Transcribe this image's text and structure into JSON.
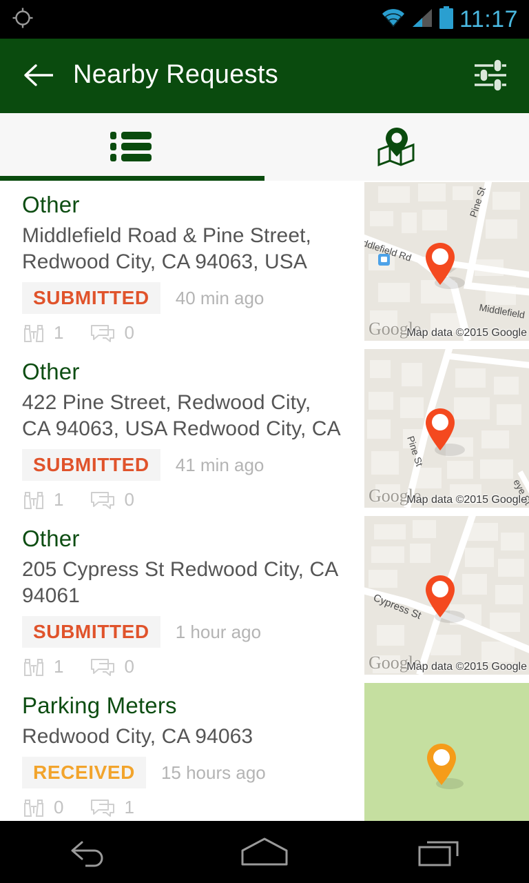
{
  "statusbar": {
    "gps_icon": "gps-crosshair-icon",
    "wifi_icon": "wifi-icon",
    "signal_icon": "cellular-signal-icon",
    "battery_icon": "battery-full-icon",
    "clock": "11:17",
    "accent_color": "#4ab8e0"
  },
  "actionbar": {
    "back_icon": "arrow-left-icon",
    "title": "Nearby Requests",
    "filter_icon": "filter-sliders-icon",
    "background_color": "#0a4b0e"
  },
  "tabs": [
    {
      "id": "list",
      "icon": "list-icon",
      "selected": true
    },
    {
      "id": "map",
      "icon": "map-pin-icon",
      "selected": false
    }
  ],
  "list": {
    "items": [
      {
        "category": "Other",
        "address": "Middlefield Road & Pine Street, Redwood City, CA 94063, USA",
        "status": "SUBMITTED",
        "status_color": "#e0532b",
        "time_ago": "40 min ago",
        "watchers": "1",
        "comments": "0",
        "map": {
          "pin_color": "#f4491f",
          "street_labels": [
            "Middlefield Rd",
            "Pine St",
            "Middlefield"
          ],
          "has_transit_marker": true,
          "logo": "Google",
          "attribution": "Map data ©2015 Google"
        }
      },
      {
        "category": "Other",
        "address": "422 Pine Street, Redwood City, CA 94063, USA Redwood City, CA",
        "status": "SUBMITTED",
        "status_color": "#e0532b",
        "time_ago": "41 min ago",
        "watchers": "1",
        "comments": "0",
        "map": {
          "pin_color": "#f4491f",
          "street_labels": [
            "Pine St",
            "eye St"
          ],
          "has_transit_marker": false,
          "logo": "Google",
          "attribution": "Map data ©2015 Google"
        }
      },
      {
        "category": "Other",
        "address": "205 Cypress St Redwood City, CA 94061",
        "status": "SUBMITTED",
        "status_color": "#e0532b",
        "time_ago": "1 hour ago",
        "watchers": "1",
        "comments": "0",
        "map": {
          "pin_color": "#f4491f",
          "street_labels": [
            "Cypress St"
          ],
          "has_transit_marker": false,
          "logo": "Google",
          "attribution": "Map data ©2015 Google"
        }
      },
      {
        "category": "Parking Meters",
        "address": " Redwood City, CA 94063",
        "status": "RECEIVED",
        "status_color": "#f2a42c",
        "time_ago": "15 hours ago",
        "watchers": "0",
        "comments": "1",
        "map": {
          "pin_color": "#f59c1a",
          "street_labels": [],
          "has_transit_marker": false,
          "logo": "",
          "attribution": ""
        }
      }
    ],
    "watchers_icon": "binoculars-icon",
    "comments_icon": "chat-bubbles-icon"
  },
  "navbar": {
    "back_icon": "nav-back-icon",
    "home_icon": "nav-home-icon",
    "recents_icon": "nav-recents-icon"
  }
}
